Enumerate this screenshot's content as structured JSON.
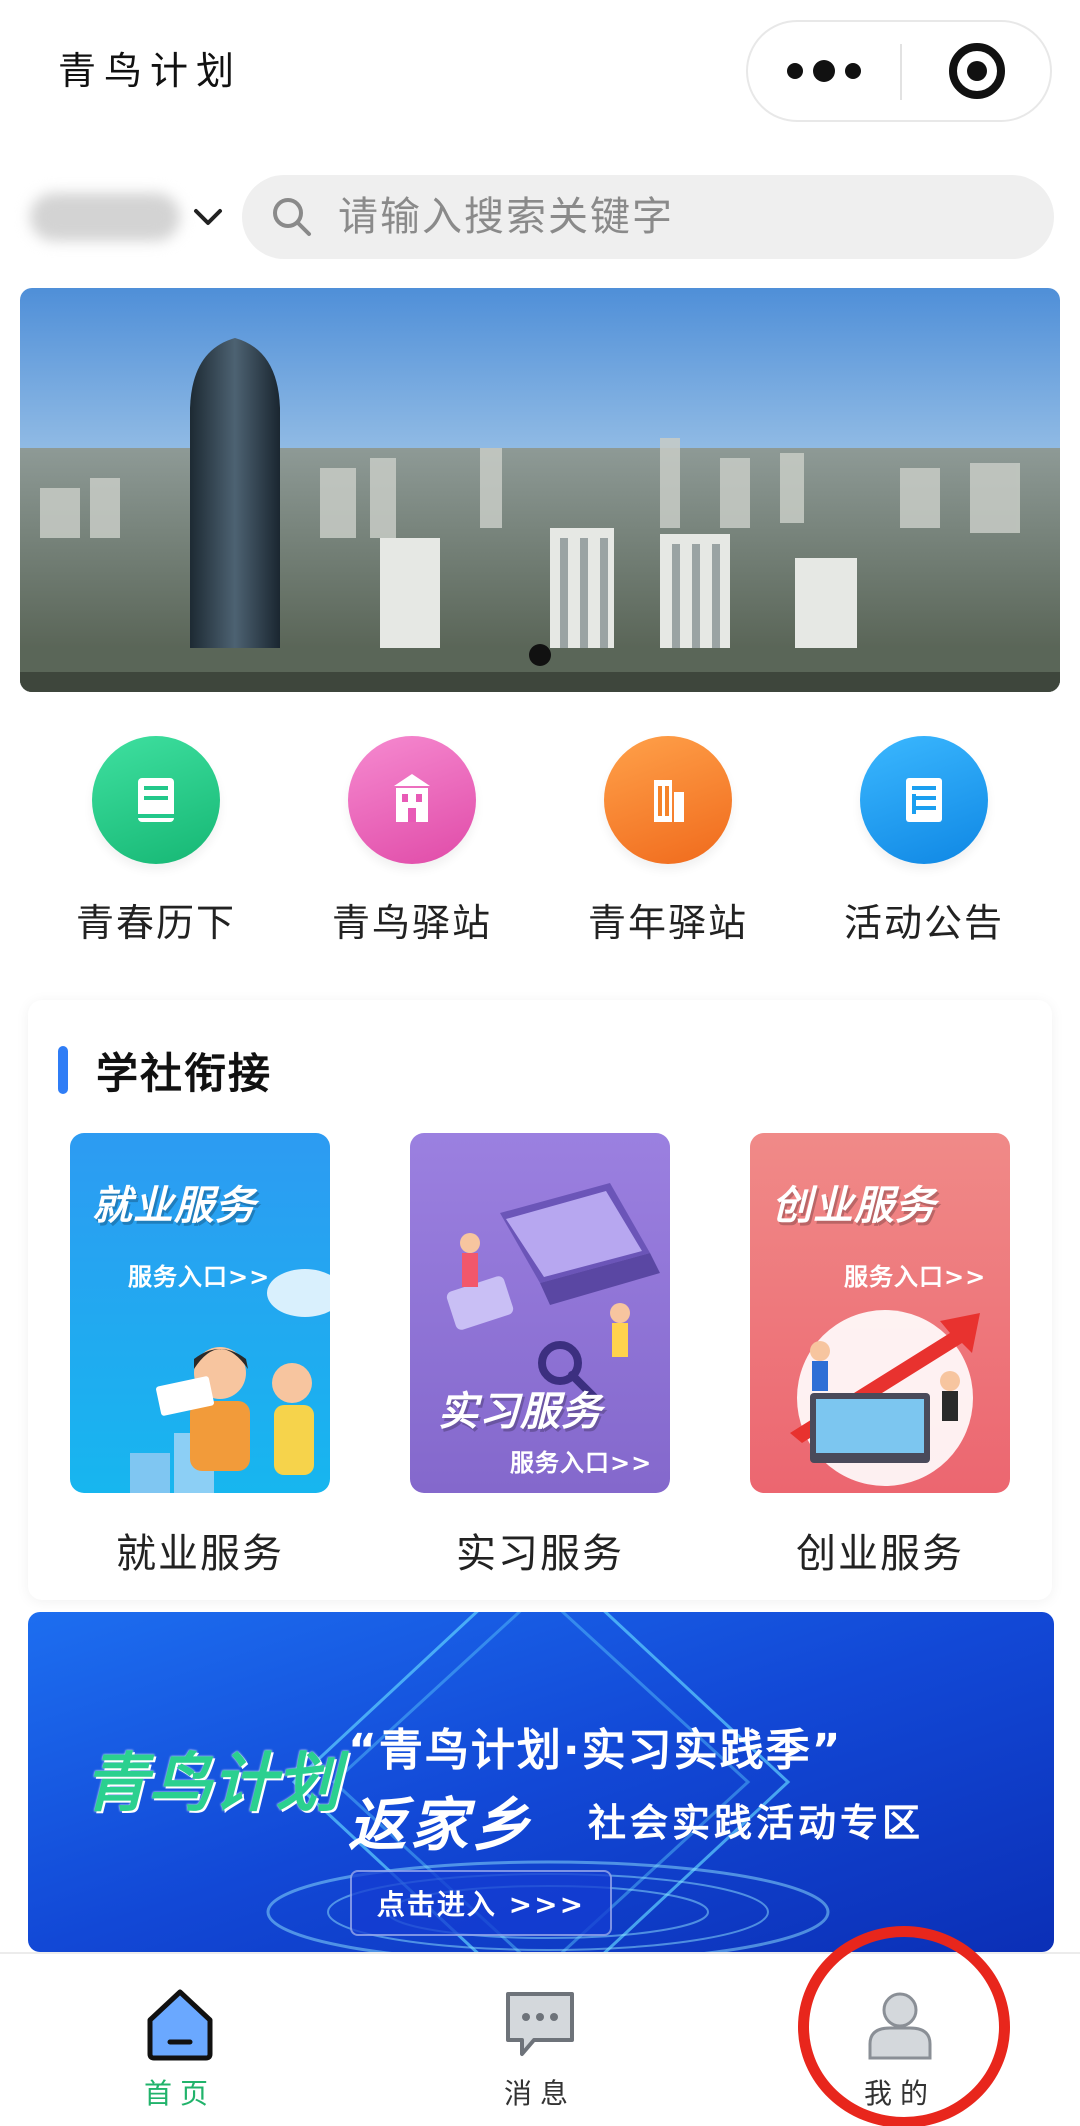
{
  "header": {
    "app_title": "青鸟计划",
    "more_icon": "more-dots-icon",
    "close_icon": "target-close-icon"
  },
  "search": {
    "location_icon": "chevron-down-icon",
    "placeholder": "请输入搜索关键字",
    "icon": "search-icon"
  },
  "banner": {
    "total_slides": 1,
    "active_slide": 1
  },
  "quick_menu": [
    {
      "label": "青春历下",
      "icon": "book-icon",
      "color": "#22c88a"
    },
    {
      "label": "青鸟驿站",
      "icon": "building-icon",
      "color": "#e85ab6"
    },
    {
      "label": "青年驿站",
      "icon": "tower-icon",
      "color": "#f5832a"
    },
    {
      "label": "活动公告",
      "icon": "notice-icon",
      "color": "#1b9ff0"
    }
  ],
  "section": {
    "title": "学社衔接",
    "services": [
      {
        "card_title": "就业服务",
        "card_sub": "服务入口>>",
        "label": "就业服务",
        "color": "#1f9ef0"
      },
      {
        "card_title": "实习服务",
        "card_sub": "服务入口>>",
        "label": "实习服务",
        "color": "#8f74d6"
      },
      {
        "card_title": "创业服务",
        "card_sub": "服务入口>>",
        "label": "创业服务",
        "color": "#ee7276"
      }
    ]
  },
  "promo": {
    "logo": "青鸟计划",
    "line1": "“青鸟计划·实习实践季”",
    "line2": "返家乡",
    "line3": "社会实践活动专区",
    "button": "点击进入 >>>"
  },
  "tabbar": {
    "items": [
      {
        "label": "首页",
        "icon": "home-icon",
        "active": true
      },
      {
        "label": "消息",
        "icon": "message-icon",
        "active": false
      },
      {
        "label": "我的",
        "icon": "profile-icon",
        "active": false
      }
    ],
    "active_color": "#21b36b",
    "inactive_color": "#333333"
  }
}
